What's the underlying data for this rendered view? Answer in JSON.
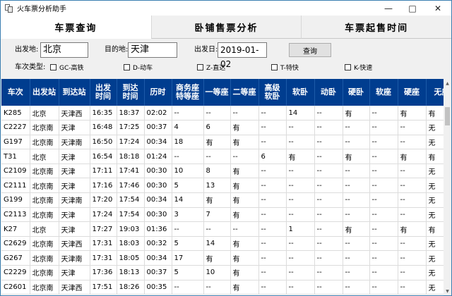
{
  "window": {
    "title": "火车票分析助手"
  },
  "tabs": [
    "车票查询",
    "卧铺售票分析",
    "车票起售时间"
  ],
  "search": {
    "from_label": "出发地:",
    "from_value": "北京",
    "to_label": "目的地:",
    "to_value": "天津",
    "date_label": "出发日:",
    "date_value": "2019-01-02",
    "query_button": "查询"
  },
  "filters": {
    "label": "车次类型:",
    "options": [
      "GC-高铁",
      "D-动车",
      "Z-直达",
      "T-特快",
      "K-快速"
    ]
  },
  "table": {
    "headers": [
      {
        "l1": "车次"
      },
      {
        "l1": "出发站"
      },
      {
        "l1": "到达站"
      },
      {
        "l1": "出发",
        "l2": "时间"
      },
      {
        "l1": "到达",
        "l2": "时间"
      },
      {
        "l1": "历时"
      },
      {
        "l1": "商务座",
        "l2": "特等座"
      },
      {
        "l1": "一等座"
      },
      {
        "l1": "二等座"
      },
      {
        "l1": "高级",
        "l2": "软卧"
      },
      {
        "l1": "软卧"
      },
      {
        "l1": "动卧"
      },
      {
        "l1": "硬卧"
      },
      {
        "l1": "软座"
      },
      {
        "l1": "硬座"
      },
      {
        "l1": "无座"
      }
    ],
    "rows": [
      [
        "K285",
        "北京",
        "天津西",
        "16:35",
        "18:37",
        "02:02",
        "--",
        "--",
        "--",
        "--",
        "14",
        "--",
        "有",
        "--",
        "有",
        "有"
      ],
      [
        "C2227",
        "北京南",
        "天津",
        "16:48",
        "17:25",
        "00:37",
        "4",
        "6",
        "有",
        "--",
        "--",
        "--",
        "--",
        "--",
        "--",
        "无"
      ],
      [
        "G197",
        "北京南",
        "天津南",
        "16:50",
        "17:24",
        "00:34",
        "18",
        "有",
        "有",
        "--",
        "--",
        "--",
        "--",
        "--",
        "--",
        "无"
      ],
      [
        "T31",
        "北京",
        "天津",
        "16:54",
        "18:18",
        "01:24",
        "--",
        "--",
        "--",
        "6",
        "有",
        "--",
        "有",
        "--",
        "有",
        "有"
      ],
      [
        "C2109",
        "北京南",
        "天津",
        "17:11",
        "17:41",
        "00:30",
        "10",
        "8",
        "有",
        "--",
        "--",
        "--",
        "--",
        "--",
        "--",
        "无"
      ],
      [
        "C2111",
        "北京南",
        "天津",
        "17:16",
        "17:46",
        "00:30",
        "5",
        "13",
        "有",
        "--",
        "--",
        "--",
        "--",
        "--",
        "--",
        "无"
      ],
      [
        "G199",
        "北京南",
        "天津南",
        "17:20",
        "17:54",
        "00:34",
        "14",
        "有",
        "有",
        "--",
        "--",
        "--",
        "--",
        "--",
        "--",
        "无"
      ],
      [
        "C2113",
        "北京南",
        "天津",
        "17:24",
        "17:54",
        "00:30",
        "3",
        "7",
        "有",
        "--",
        "--",
        "--",
        "--",
        "--",
        "--",
        "无"
      ],
      [
        "K27",
        "北京",
        "天津",
        "17:27",
        "19:03",
        "01:36",
        "--",
        "--",
        "--",
        "--",
        "1",
        "--",
        "有",
        "--",
        "有",
        "有"
      ],
      [
        "C2629",
        "北京南",
        "天津西",
        "17:31",
        "18:03",
        "00:32",
        "5",
        "14",
        "有",
        "--",
        "--",
        "--",
        "--",
        "--",
        "--",
        "无"
      ],
      [
        "G267",
        "北京南",
        "天津南",
        "17:31",
        "18:05",
        "00:34",
        "17",
        "有",
        "有",
        "--",
        "--",
        "--",
        "--",
        "--",
        "--",
        "无"
      ],
      [
        "C2229",
        "北京南",
        "天津",
        "17:36",
        "18:13",
        "00:37",
        "5",
        "10",
        "有",
        "--",
        "--",
        "--",
        "--",
        "--",
        "--",
        "无"
      ],
      [
        "C2601",
        "北京南",
        "天津西",
        "17:51",
        "18:26",
        "00:35",
        "--",
        "--",
        "有",
        "--",
        "--",
        "--",
        "--",
        "--",
        "--",
        "无"
      ]
    ]
  }
}
